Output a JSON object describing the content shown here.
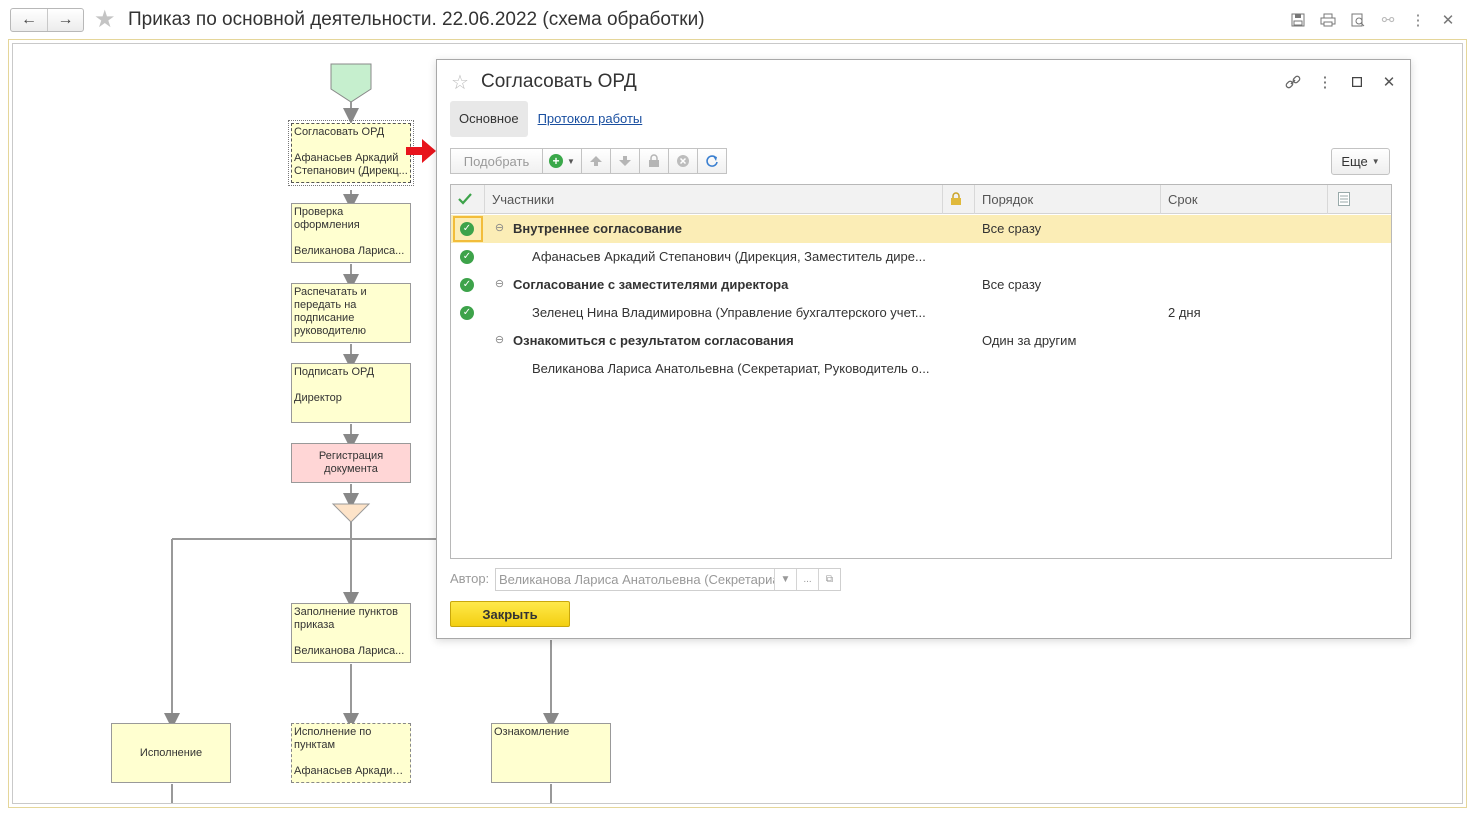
{
  "window": {
    "title": "Приказ по основной деятельности. 22.06.2022 (схема обработки)",
    "icons": [
      "save-icon",
      "print-icon",
      "preview-icon",
      "link-icon",
      "more-icon",
      "close-icon"
    ]
  },
  "process": {
    "nodes": [
      {
        "id": "n1",
        "lines": [
          "Согласовать ОРД",
          "",
          "Афанасьев Аркадий",
          "Степанович (Дирекц..."
        ]
      },
      {
        "id": "n2",
        "lines": [
          "Проверка",
          "оформления",
          "",
          "Великанова Лариса..."
        ]
      },
      {
        "id": "n3",
        "lines": [
          "Распечатать и",
          "передать на",
          "подписание",
          "руководителю"
        ]
      },
      {
        "id": "n4",
        "lines": [
          "Подписать ОРД",
          "",
          "Директор"
        ]
      },
      {
        "id": "n5",
        "lines": [
          "Регистрация",
          "документа"
        ]
      },
      {
        "id": "n6",
        "lines": [
          "Заполнение пунктов",
          "приказа",
          "",
          "Великанова Лариса..."
        ]
      },
      {
        "id": "n7",
        "lines": [
          "Исполнение"
        ]
      },
      {
        "id": "n8",
        "lines": [
          "Исполнение по",
          "пунктам",
          "",
          "Афанасьев Аркадий ..."
        ]
      },
      {
        "id": "n9",
        "lines": [
          "Ознакомление"
        ]
      }
    ]
  },
  "dialog": {
    "title": "Согласовать ОРД",
    "tabs": {
      "main": "Основное",
      "log": "Протокол работы"
    },
    "toolbar": {
      "pick": "Подобрать",
      "more": "Еще"
    },
    "columns": {
      "participants": "Участники",
      "order": "Порядок",
      "term": "Срок"
    },
    "rows": [
      {
        "checked": true,
        "group": true,
        "expanded": true,
        "name": "Внутреннее согласование",
        "order": "Все сразу",
        "term": "",
        "selected": true
      },
      {
        "checked": true,
        "group": false,
        "name": "Афанасьев Аркадий Степанович (Дирекция, Заместитель дире...",
        "order": "",
        "term": ""
      },
      {
        "checked": true,
        "group": true,
        "expanded": true,
        "name": "Согласование с заместителями директора",
        "order": "Все сразу",
        "term": ""
      },
      {
        "checked": true,
        "group": false,
        "name": "Зеленец Нина Владимировна (Управление бухгалтерского учет...",
        "order": "",
        "term": "2 дня"
      },
      {
        "checked": false,
        "group": true,
        "expanded": true,
        "name": "Ознакомиться с результатом согласования",
        "order": "Один за другим",
        "term": ""
      },
      {
        "checked": false,
        "group": false,
        "name": "Великанова Лариса Анатольевна (Секретариат, Руководитель о...",
        "order": "",
        "term": ""
      }
    ],
    "author_label": "Автор:",
    "author_value": "Великанова Лариса Анатольевна (Секретариат, Руковод",
    "close_button": "Закрыть"
  },
  "colors": {
    "accent_yellow": "#f5d417",
    "check_green": "#3da34a",
    "arrow_red": "#e8141c",
    "node_yellow": "#ffffd0",
    "node_pink": "#ffd6d6"
  }
}
